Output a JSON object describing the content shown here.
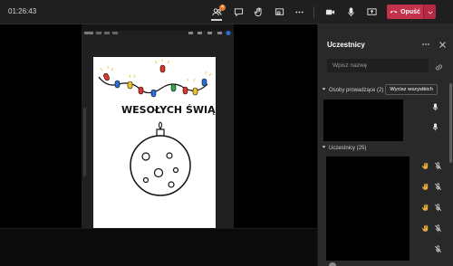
{
  "call": {
    "timer": "01:26:43",
    "participant_badge_count": "4",
    "leave_label": "Opuść"
  },
  "panel": {
    "title": "Uczestnicy",
    "search_placeholder": "Wpisz nazwę",
    "presenters_header": "Osoby prowadzące (2)",
    "mute_all_label": "Wycisz wszystkich",
    "attendees_header": "Uczestnicy (25)"
  },
  "drawing": {
    "greeting": "WESOŁYCH ŚWIĄ"
  },
  "colors": {
    "leave_red": "#c4314b",
    "badge_orange": "#e8742d",
    "raise_hand_yellow": "#e8a93c",
    "panel_bg": "#292929"
  },
  "icons": {
    "toolbar": [
      "people-icon",
      "chat-icon",
      "raise-hand-icon",
      "share-tray-icon",
      "more-icon",
      "camera-icon",
      "microphone-icon",
      "share-screen-icon",
      "phone-icon"
    ],
    "attendee_row": [
      "raise-hand-icon",
      "mic-off-icon"
    ]
  }
}
